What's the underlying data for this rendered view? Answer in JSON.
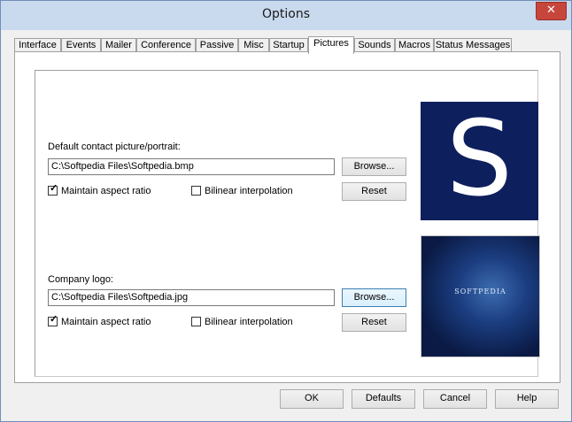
{
  "window": {
    "title": "Options",
    "close_glyph": "✕"
  },
  "tabs": [
    "Interface",
    "Events",
    "Mailer",
    "Conference",
    "Passive",
    "Misc",
    "Startup",
    "Pictures",
    "Sounds",
    "Macros",
    "Status Messages"
  ],
  "active_tab": "Pictures",
  "contact_section": {
    "label": "Default contact picture/portrait:",
    "path": "C:\\Softpedia Files\\Softpedia.bmp",
    "browse": "Browse...",
    "reset": "Reset",
    "aspect_label": "Maintain aspect ratio",
    "aspect_checked": true,
    "bilinear_label": "Bilinear interpolation",
    "bilinear_checked": false,
    "preview_letter": "S"
  },
  "logo_section": {
    "label": "Company logo:",
    "path": "C:\\Softpedia Files\\Softpedia.jpg",
    "browse": "Browse...",
    "reset": "Reset",
    "aspect_label": "Maintain aspect ratio",
    "aspect_checked": true,
    "bilinear_label": "Bilinear interpolation",
    "bilinear_checked": false,
    "preview_text": "SOFTPEDIA"
  },
  "footer": {
    "ok": "OK",
    "defaults": "Defaults",
    "cancel": "Cancel",
    "help": "Help"
  },
  "colors": {
    "titlebar": "#c9daee",
    "close": "#c7463c",
    "preview_bg": "#0d1f5c"
  }
}
